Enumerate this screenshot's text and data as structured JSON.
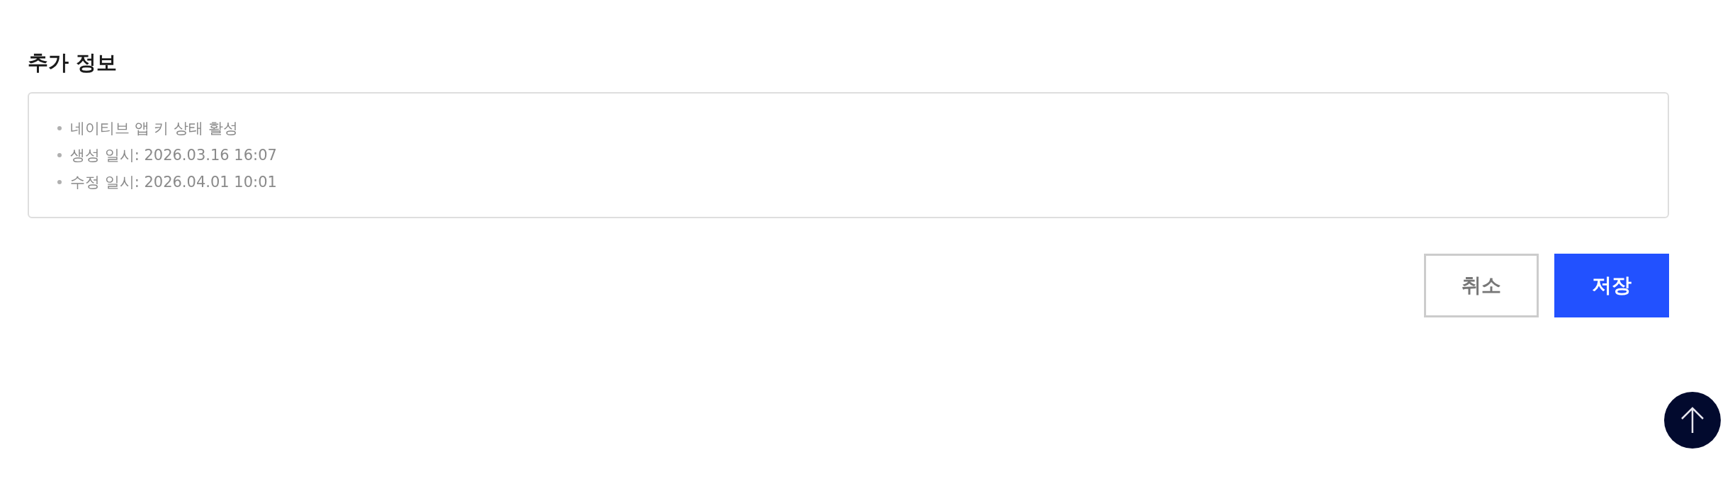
{
  "section": {
    "title": "추가 정보"
  },
  "info_items": [
    "네이티브 앱 키 상태 활성",
    "생성 일시: 2026.03.16 16:07",
    "수정 일시: 2026.04.01 10:01"
  ],
  "buttons": [
    {
      "label": "취소",
      "kind": "secondary"
    },
    {
      "label": "저장",
      "kind": "primary"
    }
  ]
}
